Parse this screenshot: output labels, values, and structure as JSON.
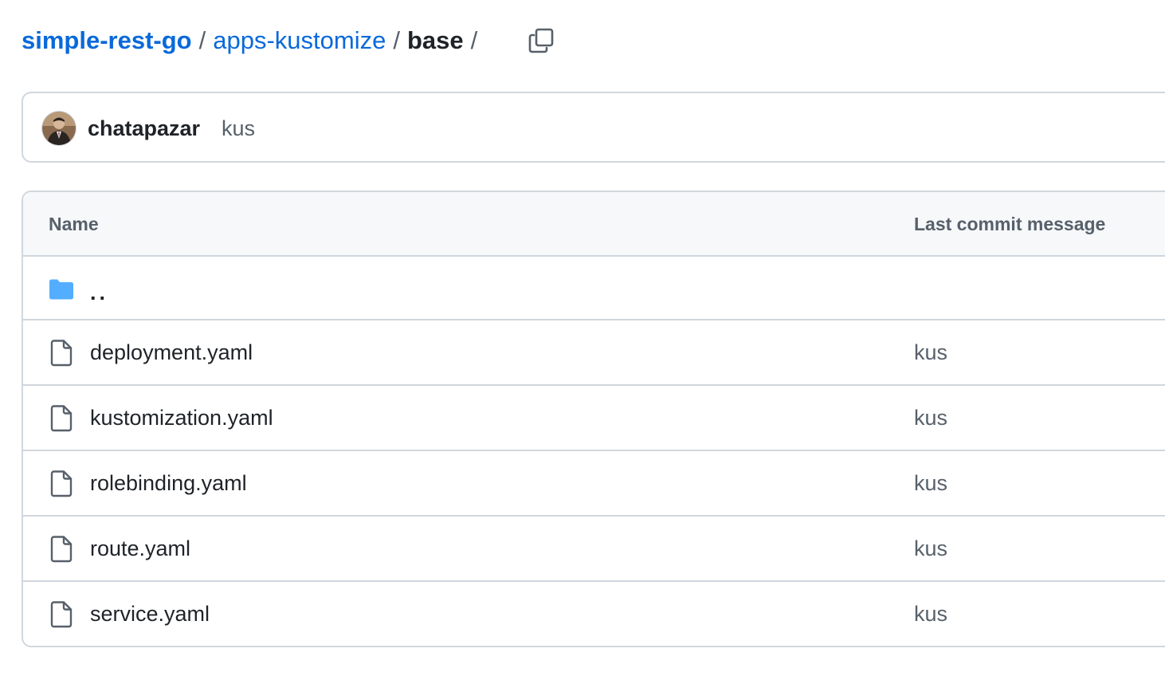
{
  "breadcrumb": {
    "repo": "simple-rest-go",
    "folder": "apps-kustomize",
    "current": "base",
    "separator": "/"
  },
  "copy_path": {
    "icon": "copy-icon"
  },
  "latest_commit": {
    "author": "chatapazar",
    "message": "kus"
  },
  "table": {
    "headers": {
      "name": "Name",
      "last_commit": "Last commit message"
    },
    "parent": {
      "label": "..",
      "icon": "folder-icon"
    },
    "rows": [
      {
        "name": "deployment.yaml",
        "message": "kus",
        "icon": "file-icon"
      },
      {
        "name": "kustomization.yaml",
        "message": "kus",
        "icon": "file-icon"
      },
      {
        "name": "rolebinding.yaml",
        "message": "kus",
        "icon": "file-icon"
      },
      {
        "name": "route.yaml",
        "message": "kus",
        "icon": "file-icon"
      },
      {
        "name": "service.yaml",
        "message": "kus",
        "icon": "file-icon"
      }
    ]
  },
  "colors": {
    "link": "#0969da",
    "text": "#1f2328",
    "muted": "#57606a",
    "border": "#d0d7de",
    "header_bg": "#f6f8fa",
    "folder": "#54aeff"
  }
}
